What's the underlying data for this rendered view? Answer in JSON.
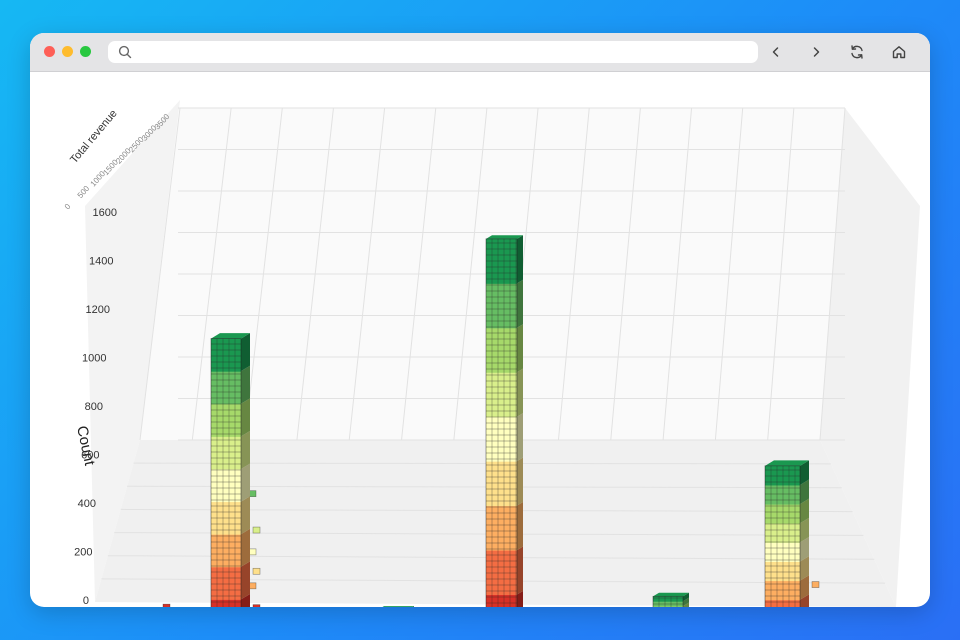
{
  "browser": {
    "address_value": "",
    "icons": [
      "search-icon",
      "back-icon",
      "forward-icon",
      "reload-icon",
      "home-icon"
    ]
  },
  "colors": {
    "ramp": [
      "#d73027",
      "#f46d43",
      "#fdae61",
      "#fee08b",
      "#ffffbf",
      "#d9ef8b",
      "#a6d96a",
      "#66bd63",
      "#1a9850"
    ],
    "grid": "#e2e2e2",
    "wall": "#f5f5f5"
  },
  "chart_data": {
    "type": "bar3d",
    "ylabel": "Count",
    "zlabel": "Total revenue",
    "y_ticks": [
      0,
      200,
      400,
      600,
      800,
      1000,
      1200,
      1400,
      1600
    ],
    "z_ticks": [
      0,
      500,
      1000,
      1500,
      2000,
      2500,
      3000,
      3500
    ],
    "ylim": [
      0,
      1600
    ],
    "grid": true,
    "bars": [
      {
        "group": 1,
        "value": 1210
      },
      {
        "group": 2,
        "value": 50
      },
      {
        "group": 3,
        "value": 40
      },
      {
        "group": 4,
        "value": 45
      },
      {
        "group": 5,
        "value": 90
      },
      {
        "group": 6,
        "value": 1650
      },
      {
        "group": 7,
        "value": 25
      },
      {
        "group": 8,
        "value": 20
      },
      {
        "group": 9,
        "value": 180
      },
      {
        "group": 10,
        "value": 45
      },
      {
        "group": 11,
        "value": 710
      },
      {
        "group": 12,
        "value": 30
      }
    ],
    "scatter": [
      {
        "group": 0,
        "value": 25
      },
      {
        "group": 1,
        "value": 60
      },
      {
        "group": 1,
        "value": 150
      },
      {
        "group": 1,
        "value": 210
      },
      {
        "group": 1,
        "value": 290
      },
      {
        "group": 1,
        "value": 380
      },
      {
        "group": 1,
        "value": 530
      },
      {
        "group": 11,
        "value": 170
      }
    ]
  }
}
